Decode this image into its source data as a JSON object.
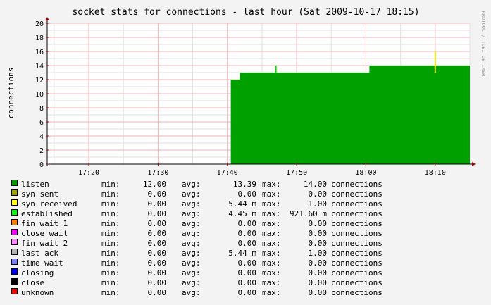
{
  "chart_data": {
    "type": "area",
    "title": "socket stats for connections - last hour (Sat 2009-10-17 18:15)",
    "ylabel": "connections",
    "watermark": "RRDTOOL / TOBI OETIKER",
    "ylim": [
      0,
      20
    ],
    "yticks": [
      0,
      2,
      4,
      6,
      8,
      10,
      12,
      14,
      16,
      18,
      20
    ],
    "xlim": [
      "17:14",
      "18:15"
    ],
    "xticks": [
      "17:20",
      "17:30",
      "17:40",
      "17:50",
      "18:00",
      "18:10"
    ],
    "grid": true,
    "series": [
      {
        "name": "listen",
        "color": "#00a000",
        "points": [
          [
            "17:14",
            null
          ],
          [
            "17:40.5",
            12
          ],
          [
            "17:41.8",
            13
          ],
          [
            "18:00.5",
            14
          ],
          [
            "18:15",
            14
          ]
        ]
      },
      {
        "name": "established",
        "color": "#00e000",
        "spikes": [
          [
            "17:47",
            14
          ]
        ]
      },
      {
        "name": "syn received",
        "color": "#e8e800",
        "spikes": [
          [
            "18:10",
            16
          ]
        ]
      }
    ],
    "legend": [
      {
        "name": "listen",
        "color": "#00a000",
        "min": "12.00",
        "avg": "13.39",
        "max": " 14.00",
        "unit": "connections"
      },
      {
        "name": "syn sent",
        "color": "#a0a000",
        "min": "0.00",
        "avg": "0.00",
        "max": "  0.00",
        "unit": "connections"
      },
      {
        "name": "syn received",
        "color": "#ffff00",
        "min": "0.00",
        "avg": "5.44 m",
        "max": "  1.00",
        "unit": "connections"
      },
      {
        "name": "established",
        "color": "#00ff00",
        "min": "0.00",
        "avg": "4.45 m",
        "max": "921.60 m",
        "unit": "connections"
      },
      {
        "name": "fin wait 1",
        "color": "#ff8000",
        "min": "0.00",
        "avg": "0.00",
        "max": "  0.00",
        "unit": "connections"
      },
      {
        "name": "close wait",
        "color": "#ff00ff",
        "min": "0.00",
        "avg": "0.00",
        "max": "  0.00",
        "unit": "connections"
      },
      {
        "name": "fin wait 2",
        "color": "#ff80ff",
        "min": "0.00",
        "avg": "0.00",
        "max": "  0.00",
        "unit": "connections"
      },
      {
        "name": "last ack",
        "color": "#b0b0b0",
        "min": "0.00",
        "avg": "5.44 m",
        "max": "  1.00",
        "unit": "connections"
      },
      {
        "name": "time wait",
        "color": "#8080ff",
        "min": "0.00",
        "avg": "0.00",
        "max": "  0.00",
        "unit": "connections"
      },
      {
        "name": "closing",
        "color": "#0000ff",
        "min": "0.00",
        "avg": "0.00",
        "max": "  0.00",
        "unit": "connections"
      },
      {
        "name": "close",
        "color": "#000000",
        "min": "0.00",
        "avg": "0.00",
        "max": "  0.00",
        "unit": "connections"
      },
      {
        "name": "unknown",
        "color": "#ff0000",
        "min": "0.00",
        "avg": "0.00",
        "max": "  0.00",
        "unit": "connections"
      }
    ],
    "labels": {
      "min": "min:",
      "avg": "avg:",
      "max": "max:"
    }
  }
}
